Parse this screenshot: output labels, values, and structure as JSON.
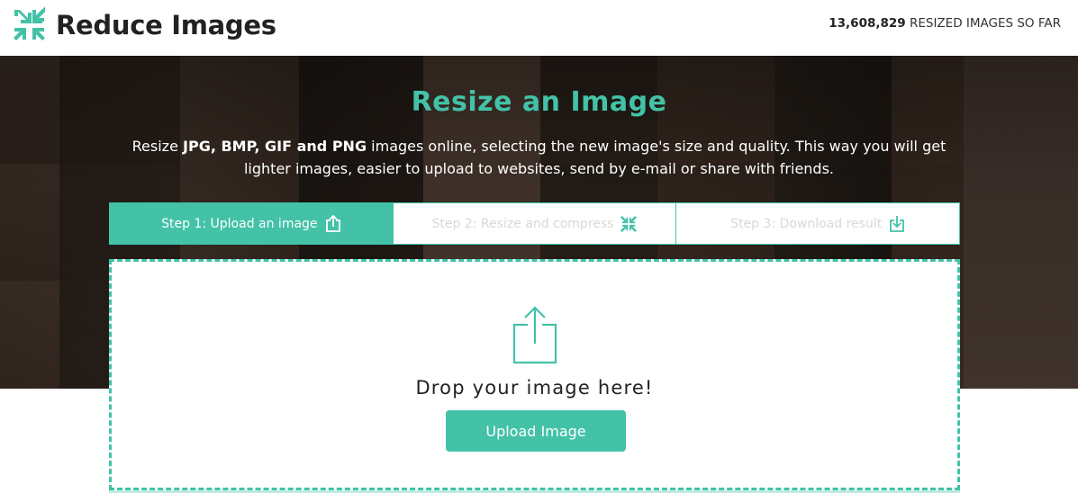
{
  "header": {
    "logo_text": "Reduce Images",
    "counter_number": "13,608,829",
    "counter_suffix": " RESIZED IMAGES SO FAR"
  },
  "hero": {
    "title": "Resize an Image",
    "desc_prefix": "Resize ",
    "desc_formats": "JPG, BMP, GIF and PNG",
    "desc_suffix": " images online, selecting the new image's size and quality. This way you will get lighter images, easier to upload to websites, send by e-mail or share with friends."
  },
  "steps": [
    {
      "label": "Step 1: Upload an image",
      "icon": "upload-icon",
      "active": true
    },
    {
      "label": "Step 2: Resize and compress",
      "icon": "compress-icon",
      "active": false
    },
    {
      "label": "Step 3: Download result",
      "icon": "download-icon",
      "active": false
    }
  ],
  "dropzone": {
    "icon": "upload-icon",
    "text": "Drop your image here!",
    "button_label": "Upload Image"
  },
  "colors": {
    "accent": "#43c2a8",
    "hero_background": "#241c18",
    "step_inactive_text": "#d8d8d8"
  }
}
